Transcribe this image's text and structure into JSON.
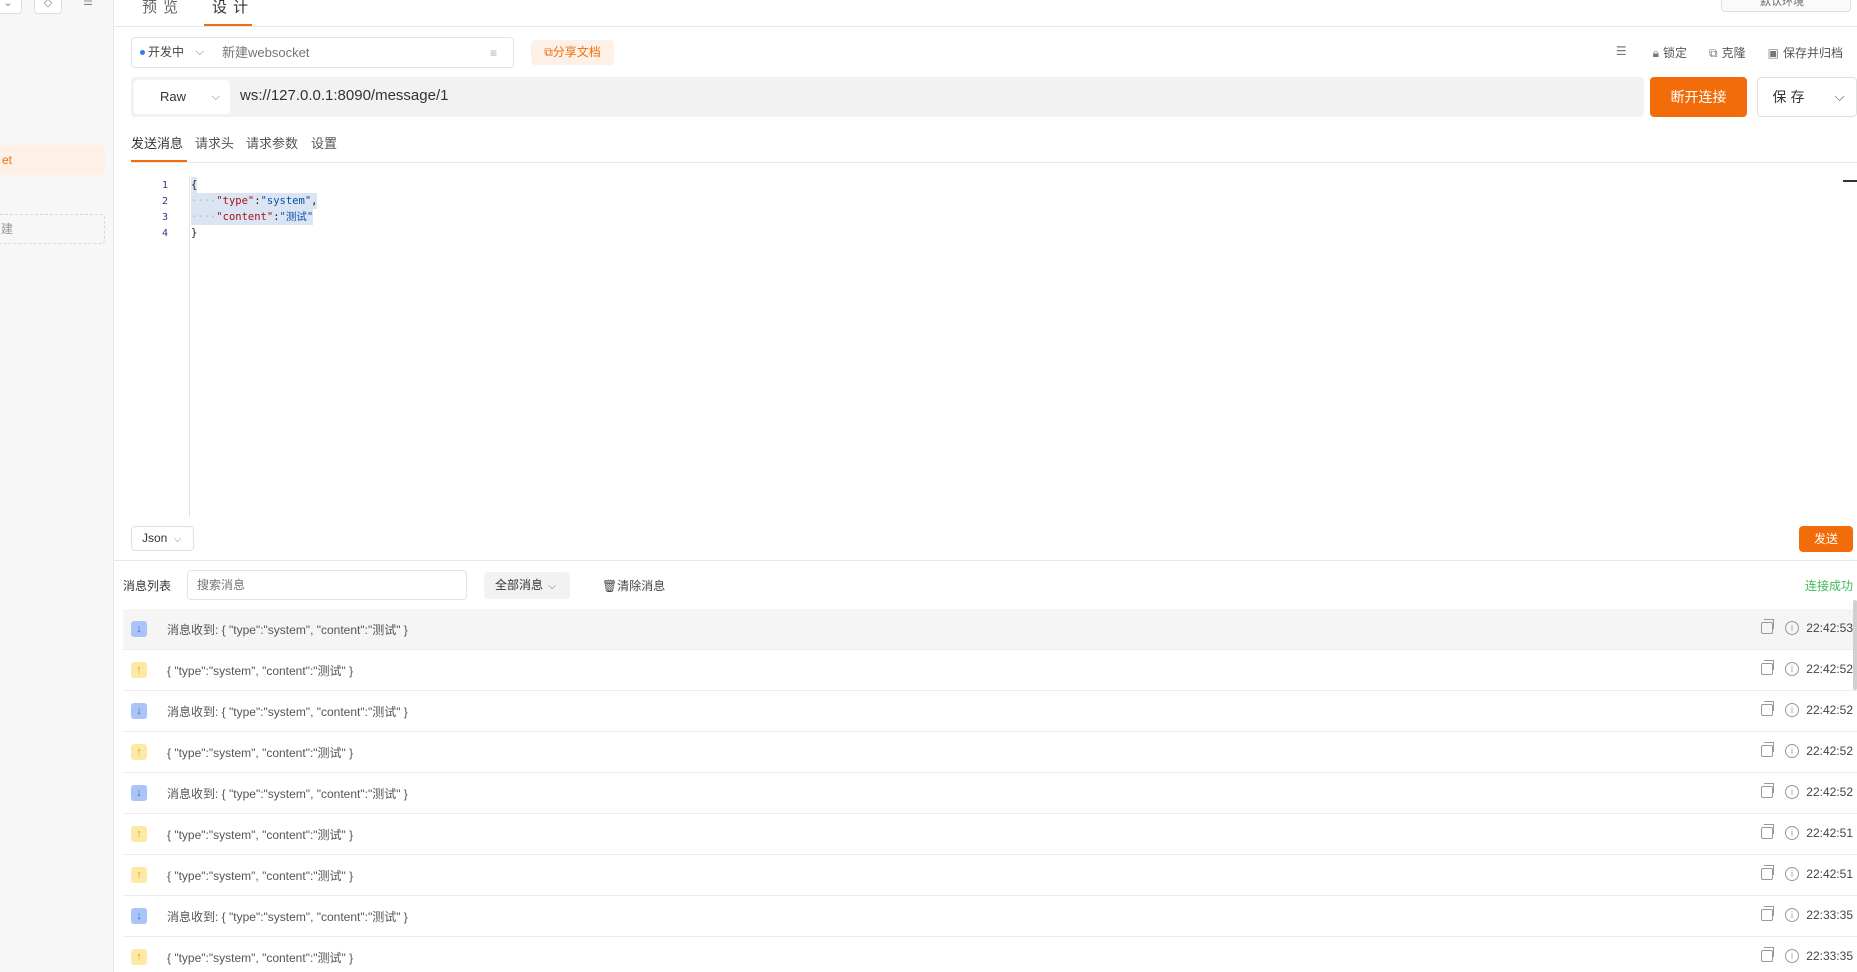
{
  "sidebar": {
    "active_item_partial": "et",
    "dashed_item_partial": "建"
  },
  "top_tabs": [
    {
      "label": "预览"
    },
    {
      "label": "设计"
    }
  ],
  "env_label": "默认环境",
  "toolbar": {
    "status_label": "开发中",
    "name_placeholder": "新建websocket",
    "share_label": "分享文档",
    "lock_label": "锁定",
    "clone_label": "克隆",
    "save_archive_label": "保存并归档"
  },
  "request": {
    "method": "Raw",
    "url": "ws://127.0.0.1:8090/message/1",
    "disconnect_label": "断开连接",
    "save_label": "保存"
  },
  "sub_tabs": [
    {
      "label": "发送消息"
    },
    {
      "label": "请求头"
    },
    {
      "label": "请求参数"
    },
    {
      "label": "设置"
    }
  ],
  "editor": {
    "line_numbers": [
      "1",
      "2",
      "3",
      "4"
    ],
    "lines": {
      "l1": "{",
      "l2_indent": "····",
      "l2_key": "\"type\"",
      "l2_colon": ":",
      "l2_value": "\"system\"",
      "l2_comma": ",",
      "l3_indent": "····",
      "l3_key": "\"content\"",
      "l3_colon": ":",
      "l3_value": "\"测试\"",
      "l4": "}"
    },
    "format": "Json",
    "send_label": "发送"
  },
  "messages": {
    "title": "消息列表",
    "search_placeholder": "搜索消息",
    "filter_label": "全部消息",
    "clear_label": "清除消息",
    "connection_status": "连接成功",
    "rows": [
      {
        "direction": "received",
        "icon": "arrow-down-icon",
        "text": "消息收到: { \"type\":\"system\", \"content\":\"测试\" }",
        "time": "22:42:53"
      },
      {
        "direction": "sent",
        "icon": "arrow-up-icon",
        "text": "{ \"type\":\"system\", \"content\":\"测试\" }",
        "time": "22:42:52"
      },
      {
        "direction": "received",
        "icon": "arrow-down-icon",
        "text": "消息收到: { \"type\":\"system\", \"content\":\"测试\" }",
        "time": "22:42:52"
      },
      {
        "direction": "sent",
        "icon": "arrow-up-icon",
        "text": "{ \"type\":\"system\", \"content\":\"测试\" }",
        "time": "22:42:52"
      },
      {
        "direction": "received",
        "icon": "arrow-down-icon",
        "text": "消息收到: { \"type\":\"system\", \"content\":\"测试\" }",
        "time": "22:42:52"
      },
      {
        "direction": "sent",
        "icon": "arrow-up-icon",
        "text": "{ \"type\":\"system\", \"content\":\"测试\" }",
        "time": "22:42:51"
      },
      {
        "direction": "sent",
        "icon": "arrow-up-icon",
        "text": "{ \"type\":\"system\", \"content\":\"测试\" }",
        "time": "22:42:51"
      },
      {
        "direction": "received",
        "icon": "arrow-down-icon",
        "text": "消息收到: { \"type\":\"system\", \"content\":\"测试\" }",
        "time": "22:33:35"
      },
      {
        "direction": "sent",
        "icon": "arrow-up-icon",
        "text": "{ \"type\":\"system\", \"content\":\"测试\" }",
        "time": "22:33:35"
      }
    ]
  },
  "colors": {
    "accent": "#f26d0a",
    "success": "#3dbb5b",
    "received_icon_bg": "#a9c4f7",
    "sent_icon_bg": "#fde9a6"
  }
}
